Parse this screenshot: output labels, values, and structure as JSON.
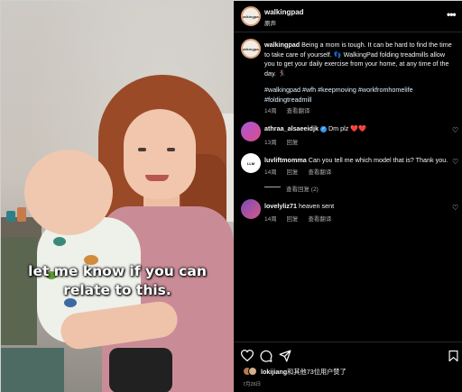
{
  "video": {
    "caption_lines": [
      "let me know if you can",
      "relate to this."
    ]
  },
  "header": {
    "username": "walkingpad",
    "subtitle": "原声",
    "avatar_text": "walkingpad"
  },
  "post": {
    "author": "walkingpad",
    "text": "Being a mom is tough. It can be hard to find the time to take care of yourself. 👣 WalkingPad folding treadmills allow you to get your daily exercise from your home, at any time of the day. 🏃‍♀️",
    "hashtags": "#walkingpad #wfh #keepmoving #workfromhomelife #foldingtreadmill",
    "time": "14周",
    "translate": "查看翻译"
  },
  "comments": [
    {
      "username": "athraa_alsaeeidjk",
      "verified": true,
      "text": "Dm plz ❤️❤️",
      "time": "13周",
      "reply": "回复"
    },
    {
      "username": "luvliftmomma",
      "text": "Can you tell me which model that is? Thank you.",
      "time": "14周",
      "reply": "回复",
      "translate": "查看翻译",
      "view_replies": "查看回复 (2)"
    },
    {
      "username": "lovelyliz71",
      "text": "heaven sent",
      "time": "14周",
      "reply": "回复",
      "translate": "查看翻译"
    }
  ],
  "footer": {
    "liked_by_user": "lokijiang",
    "liked_rest": "和其他73位用户赞了",
    "date": "7月26日"
  },
  "icons": {
    "more": "more-icon",
    "like": "heart-icon",
    "comment": "comment-icon",
    "share": "share-icon",
    "save": "bookmark-icon"
  },
  "colors": {
    "background": "#000000",
    "text": "#f5f5f5",
    "secondary": "#a8a8a8",
    "hashtag": "#e0f1ff",
    "verified": "#3797f0",
    "heart": "#ff3040"
  }
}
